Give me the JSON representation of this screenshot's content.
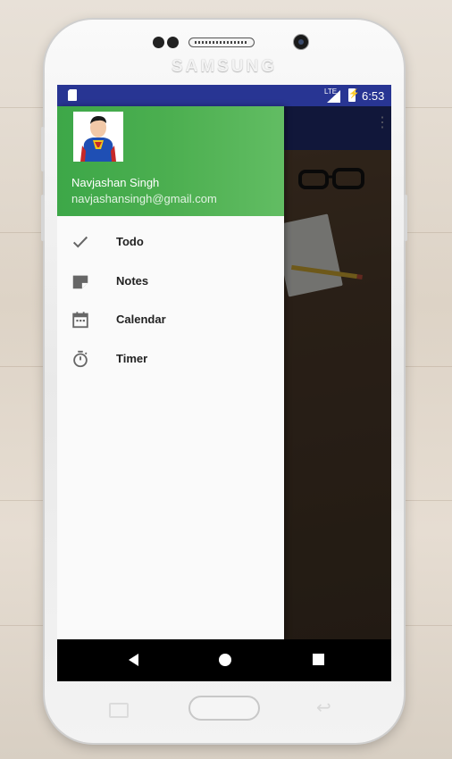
{
  "device": {
    "brand": "SAMSUNG"
  },
  "status_bar": {
    "network": "LTE",
    "time": "6:53"
  },
  "drawer": {
    "header": {
      "name": "Navjashan Singh",
      "email": "navjashansingh@gmail.com"
    },
    "items": [
      {
        "label": "Todo",
        "icon": "check-icon"
      },
      {
        "label": "Notes",
        "icon": "note-icon"
      },
      {
        "label": "Calendar",
        "icon": "calendar-icon"
      },
      {
        "label": "Timer",
        "icon": "timer-icon"
      }
    ]
  },
  "colors": {
    "status_bar": "#283593",
    "drawer_header": "#4caf50",
    "drawer_bg": "#fafafa",
    "nav_bar": "#000000"
  }
}
